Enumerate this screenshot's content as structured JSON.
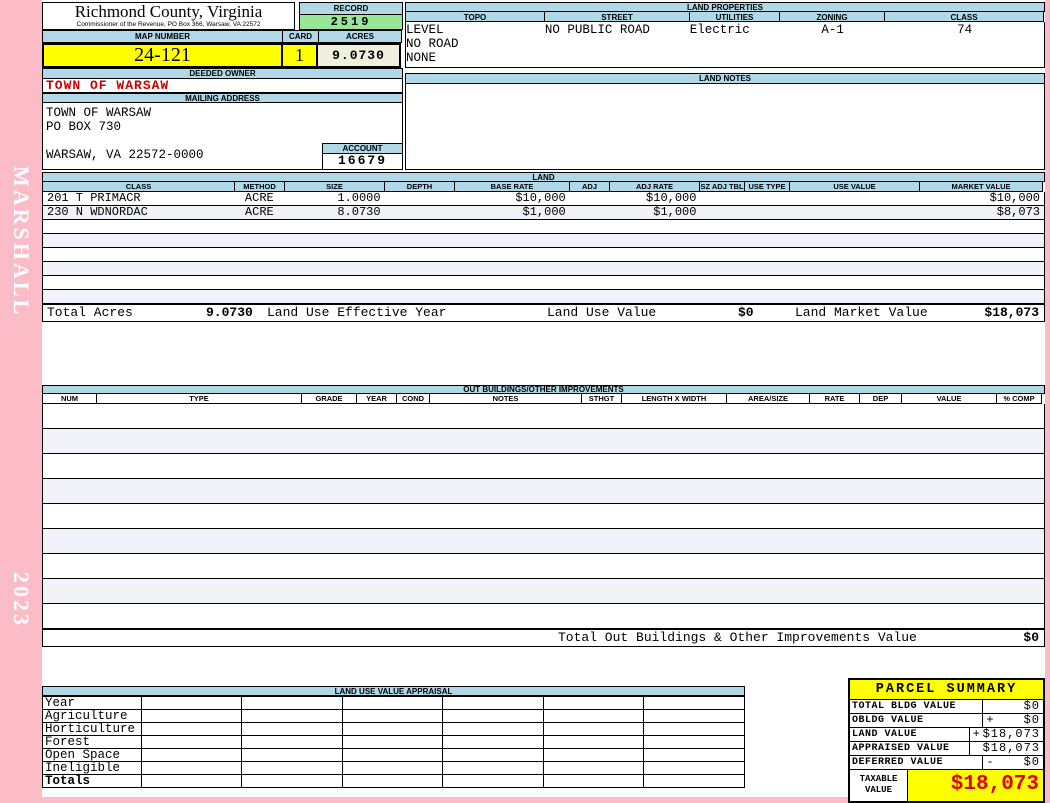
{
  "sidebar": {
    "vendor_label": "MARSHALL",
    "year": "2023"
  },
  "header": {
    "county_title": "Richmond County, Virginia",
    "commissioner_line": "Commissioner of the Revenue, PO Box 366, Warsaw, VA 22572",
    "record_label": "RECORD",
    "record_value": "2519",
    "map_number_label": "MAP NUMBER",
    "map_number_value": "24-121",
    "card_label": "CARD",
    "card_value": "1",
    "acres_label": "ACRES",
    "acres_value": "9.0730"
  },
  "owner": {
    "deeded_owner_label": "DEEDED OWNER",
    "deeded_owner": "TOWN OF WARSAW",
    "mailing_address_label": "MAILING ADDRESS",
    "address_line1": "TOWN OF WARSAW",
    "address_line2": "PO BOX 730",
    "address_line3": "WARSAW, VA 22572-0000",
    "account_label": "ACCOUNT",
    "account_value": "16679"
  },
  "land_properties": {
    "title": "LAND PROPERTIES",
    "columns": [
      "TOPO",
      "STREET",
      "UTILITIES",
      "ZONING",
      "CLASS"
    ],
    "topo_values": [
      "LEVEL",
      "NO ROAD",
      "NONE"
    ],
    "street": "NO PUBLIC ROAD",
    "utilities": "Electric",
    "zoning": "A-1",
    "class": "74"
  },
  "land_notes": {
    "title": "LAND NOTES"
  },
  "land": {
    "title": "LAND",
    "columns": [
      "CLASS",
      "METHOD",
      "SIZE",
      "DEPTH",
      "BASE RATE",
      "ADJ",
      "ADJ RATE",
      "SZ ADJ TBL",
      "USE TYPE",
      "USE VALUE",
      "MARKET VALUE"
    ],
    "rows": [
      {
        "class": "201 T PRIMACR",
        "method": "ACRE",
        "size": "1.0000",
        "depth": "",
        "base_rate": "$10,000",
        "adj": "",
        "adj_rate": "$10,000",
        "sz_adj_tbl": "",
        "use_type": "",
        "use_value": "",
        "market_value": "$10,000"
      },
      {
        "class": "230 N WDNORDAC",
        "method": "ACRE",
        "size": "8.0730",
        "depth": "",
        "base_rate": "$1,000",
        "adj": "",
        "adj_rate": "$1,000",
        "sz_adj_tbl": "",
        "use_type": "",
        "use_value": "",
        "market_value": "$8,073"
      }
    ],
    "totals": {
      "total_acres_label": "Total Acres",
      "total_acres": "9.0730",
      "effective_year_label": "Land Use Effective Year",
      "land_use_value_label": "Land Use Value",
      "land_use_value": "$0",
      "land_market_value_label": "Land Market Value",
      "land_market_value": "$18,073"
    }
  },
  "out_buildings": {
    "title": "OUT BUILDINGS/OTHER IMPROVEMENTS",
    "columns": [
      "NUM",
      "TYPE",
      "GRADE",
      "YEAR",
      "COND",
      "NOTES",
      "STHGT",
      "LENGTH X WIDTH",
      "AREA/SIZE",
      "RATE",
      "DEP",
      "VALUE",
      "% COMP"
    ],
    "total_label": "Total Out Buildings & Other Improvements Value",
    "total_value": "$0"
  },
  "land_use_appraisal": {
    "title": "LAND USE VALUE APPRAISAL",
    "row_labels": [
      "Year",
      "Agriculture",
      "Horticulture",
      "Forest",
      "Open Space",
      "Ineligible",
      "Totals"
    ]
  },
  "parcel_summary": {
    "title": "PARCEL SUMMARY",
    "rows": [
      {
        "label": "TOTAL BLDG VALUE",
        "sign": "",
        "value": "$0"
      },
      {
        "label": "OBLDG VALUE",
        "sign": "+",
        "value": "$0"
      },
      {
        "label": "LAND VALUE",
        "sign": "+",
        "value": "$18,073"
      },
      {
        "label": "APPRAISED VALUE",
        "sign": "",
        "value": "$18,073"
      },
      {
        "label": "DEFERRED VALUE",
        "sign": "-",
        "value": "$0"
      }
    ],
    "taxable_label_line1": "TAXABLE",
    "taxable_label_line2": "VALUE",
    "taxable_value": "$18,073"
  },
  "colors": {
    "sidebar_pink": "#FBBCC8",
    "header_blue": "#B0D8E6",
    "record_green": "#98E698",
    "highlight_yellow": "#FFFF00",
    "acres_cream": "#EFEFDE",
    "row_alt_lavender": "#F2F2FA",
    "red_text": "#CC0000",
    "taxable_red": "#DD0000"
  }
}
